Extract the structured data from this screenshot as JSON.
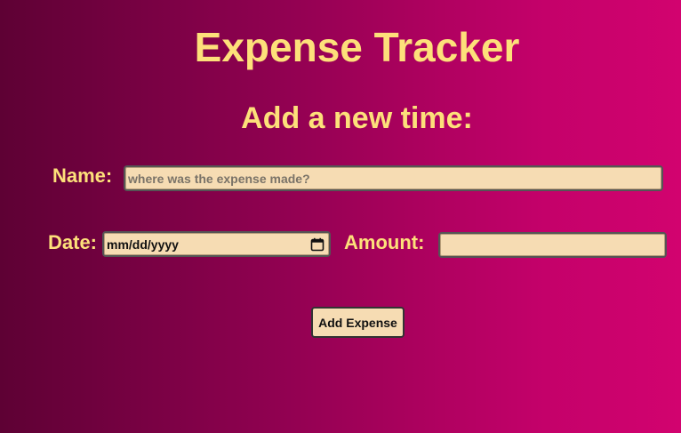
{
  "header": {
    "title": "Expense Tracker",
    "subtitle": "Add a new time:"
  },
  "form": {
    "name_label": "Name:",
    "name_placeholder": "where was the expense made?",
    "date_label": "Date:",
    "date_value": "mm/dd/yyyy",
    "date_icon": "calendar-icon",
    "amount_label": "Amount:",
    "amount_value": "",
    "submit_label": "Add Expense"
  },
  "colors": {
    "text_accent": "#fde07a",
    "input_background": "#f6dcb3",
    "gradient_start": "#5e0134",
    "gradient_end": "#d2036f"
  }
}
